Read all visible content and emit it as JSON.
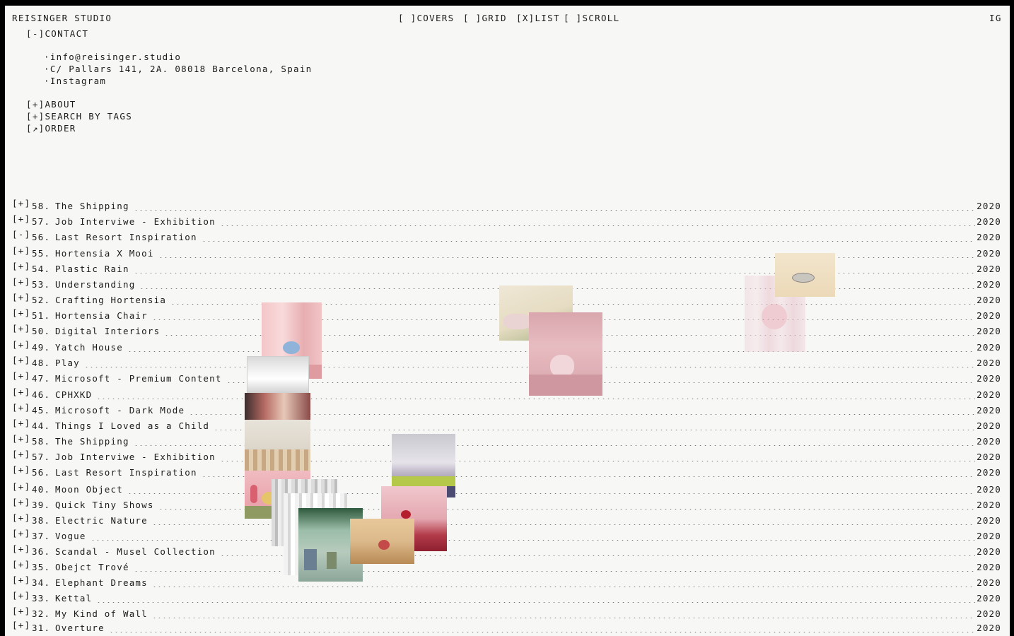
{
  "header": {
    "brand": "REISINGER STUDIO",
    "view_modes": [
      "[ ]COVERS",
      "[ ]GRID",
      "[X]LIST",
      "[ ]SCROLL"
    ],
    "ig": "IG"
  },
  "menu": {
    "contact_toggle": "[-]CONTACT",
    "contact_items": [
      "·info@reisinger.studio",
      "·C/ Pallars 141, 2A. 08018 Barcelona, Spain",
      "·Instagram"
    ],
    "about": "[+]ABOUT",
    "search_tags": "[+]SEARCH BY TAGS",
    "order": "[↗]ORDER"
  },
  "projects": [
    {
      "prefix": "[+]",
      "num": "58.",
      "title": "The Shipping",
      "year": "2020"
    },
    {
      "prefix": "[+]",
      "num": "57.",
      "title": "Job Interviwe - Exhibition",
      "year": "2020"
    },
    {
      "prefix": "[-]",
      "num": "56.",
      "title": "Last Resort Inspiration",
      "year": "2020"
    },
    {
      "prefix": "[+]",
      "num": "55.",
      "title": "Hortensia X Mooi",
      "year": "2020"
    },
    {
      "prefix": "[+]",
      "num": "54.",
      "title": "Plastic Rain",
      "year": "2020"
    },
    {
      "prefix": "[+]",
      "num": "53.",
      "title": "Understanding",
      "year": "2020"
    },
    {
      "prefix": "[+]",
      "num": "52.",
      "title": "Crafting Hortensia",
      "year": "2020"
    },
    {
      "prefix": "[+]",
      "num": "51.",
      "title": "Hortensia Chair",
      "year": "2020"
    },
    {
      "prefix": "[+]",
      "num": "50.",
      "title": "Digital Interiors",
      "year": "2020"
    },
    {
      "prefix": "[+]",
      "num": "49.",
      "title": "Yatch House",
      "year": "2020"
    },
    {
      "prefix": "[+]",
      "num": "48.",
      "title": "Play",
      "year": "2020"
    },
    {
      "prefix": "[+]",
      "num": "47.",
      "title": "Microsoft - Premium Content",
      "year": "2020"
    },
    {
      "prefix": "[+]",
      "num": "46.",
      "title": "CPHXKD",
      "year": "2020"
    },
    {
      "prefix": "[+]",
      "num": "45.",
      "title": "Microsoft - Dark Mode",
      "year": "2020"
    },
    {
      "prefix": "[+]",
      "num": "44.",
      "title": "Things I Loved as a Child",
      "year": "2020"
    },
    {
      "prefix": "[+]",
      "num": "58.",
      "title": "The Shipping",
      "year": "2020"
    },
    {
      "prefix": "[+]",
      "num": "57.",
      "title": "Job Interviwe - Exhibition",
      "year": "2020"
    },
    {
      "prefix": "[+]",
      "num": "56.",
      "title": "Last Resort Inspiration",
      "year": "2020"
    },
    {
      "prefix": "[+]",
      "num": "40.",
      "title": "Moon Object",
      "year": "2020"
    },
    {
      "prefix": "[+]",
      "num": "39.",
      "title": "Quick Tiny Shows",
      "year": "2020"
    },
    {
      "prefix": "[+]",
      "num": "38.",
      "title": "Electric Nature",
      "year": "2020"
    },
    {
      "prefix": "[+]",
      "num": "37.",
      "title": "Vogue",
      "year": "2020"
    },
    {
      "prefix": "[+]",
      "num": "36.",
      "title": "Scandal - Musel Collection",
      "year": "2020"
    },
    {
      "prefix": "[+]",
      "num": "35.",
      "title": "Obejct Trové",
      "year": "2020"
    },
    {
      "prefix": "[+]",
      "num": "34.",
      "title": "Elephant Dreams",
      "year": "2020"
    },
    {
      "prefix": "[+]",
      "num": "33.",
      "title": "Kettal",
      "year": "2020"
    },
    {
      "prefix": "[+]",
      "num": "32.",
      "title": "My Kind of Wall",
      "year": "2020"
    },
    {
      "prefix": "[+]",
      "num": "31.",
      "title": "Overture",
      "year": "2020"
    }
  ],
  "colors": {
    "background": "#f7f7f6",
    "text": "#1b1b1b",
    "frame": "#000000"
  }
}
